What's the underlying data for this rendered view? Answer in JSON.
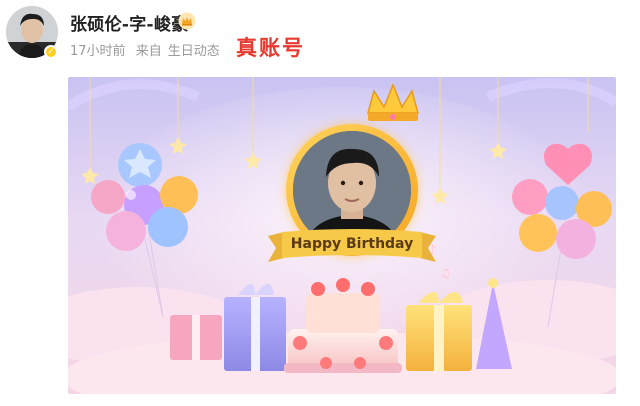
{
  "post": {
    "username": "张硕伦-字-峻豪",
    "time": "17小时前",
    "source_prefix": "来自",
    "source_name": "生日动态",
    "annotation": "真账号"
  },
  "card": {
    "banner_text": "Happy Birthday"
  },
  "colors": {
    "annotation_red": "#e8392f",
    "verified_badge": "#ffcf1f",
    "banner_gold": "#f7c948"
  },
  "icons": {
    "verified": "verified-badge-icon",
    "vip": "crown-icon"
  }
}
